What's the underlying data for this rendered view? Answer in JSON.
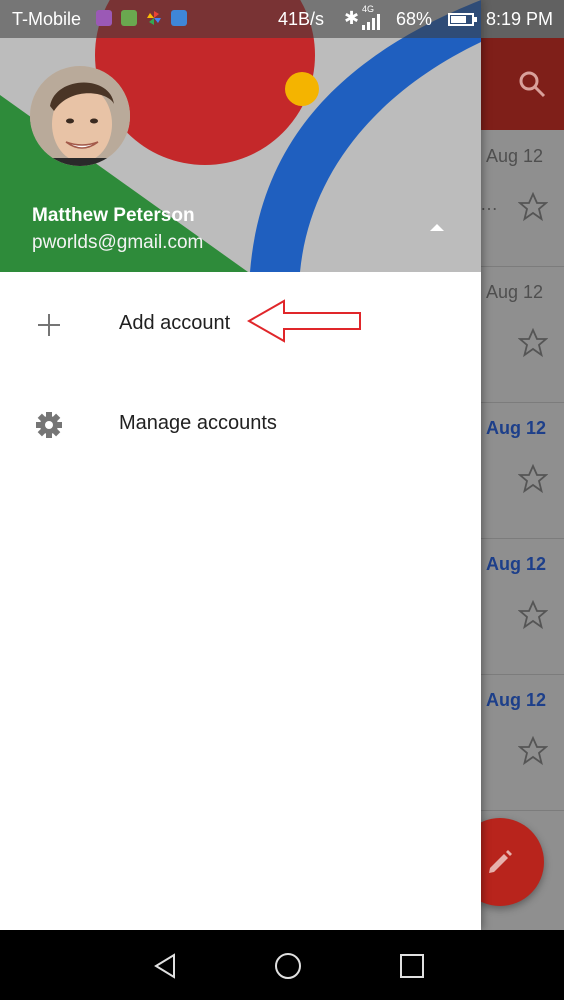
{
  "status_bar": {
    "carrier": "T-Mobile",
    "speed": "41B/s",
    "network": "4G",
    "battery": "68%",
    "time": "8:19 PM"
  },
  "drawer": {
    "user_name": "Matthew Peterson",
    "user_email": "pworlds@gmail.com",
    "menu": [
      {
        "label": "Add account",
        "icon": "plus-icon"
      },
      {
        "label": "Manage accounts",
        "icon": "gear-icon"
      }
    ]
  },
  "inbox": {
    "rows": [
      {
        "date": "Aug 12",
        "unread": false
      },
      {
        "date": "Aug 12",
        "unread": false
      },
      {
        "date": "Aug 12",
        "unread": true
      },
      {
        "date": "Aug 12",
        "unread": true
      },
      {
        "date": "Aug 12",
        "unread": true
      }
    ]
  },
  "colors": {
    "accent_red": "#db4437",
    "accent_blue": "#1f5fbf",
    "accent_green": "#2e8b3a",
    "accent_yellow": "#f4b400",
    "annotation_red": "#e0262a"
  }
}
